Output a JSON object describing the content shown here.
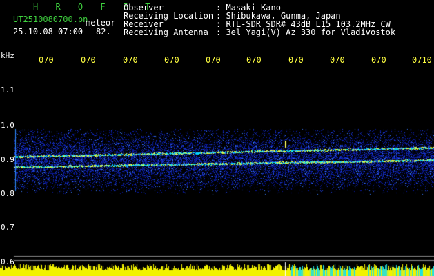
{
  "header": {
    "title": "H R O F F T",
    "filename": "UT2510080700.pn",
    "meteor": "meteor",
    "datetime": "25.10.08 07:00",
    "count": "82.",
    "rows": [
      {
        "label": "Observer",
        "value": ": Masaki Kano"
      },
      {
        "label": "Receiving Location",
        "value": ": Shibukawa, Gunma, Japan"
      },
      {
        "label": "Receiver",
        "value": ": RTL-SDR SDR# 43dB L15 103.2MHz CW"
      },
      {
        "label": "Receiving Antenna",
        "value": ": 3el Yagi(V) Az 330 for Vladivostok"
      }
    ]
  },
  "axis": {
    "unit": "kHz",
    "time_ticks": [
      "070",
      "070",
      "070",
      "070",
      "070",
      "070",
      "070",
      "070",
      "070",
      "0710"
    ],
    "y_ticks": [
      "1.1",
      "1.0",
      "0.9",
      "0.8",
      "0.7",
      "0.6"
    ]
  },
  "colors": {
    "background": "#000000",
    "title_green": "#3fd23f",
    "tick_yellow": "#ffff40",
    "signal_cyan": "#00e5ff",
    "noise_blue": "#1b3bd6"
  }
}
